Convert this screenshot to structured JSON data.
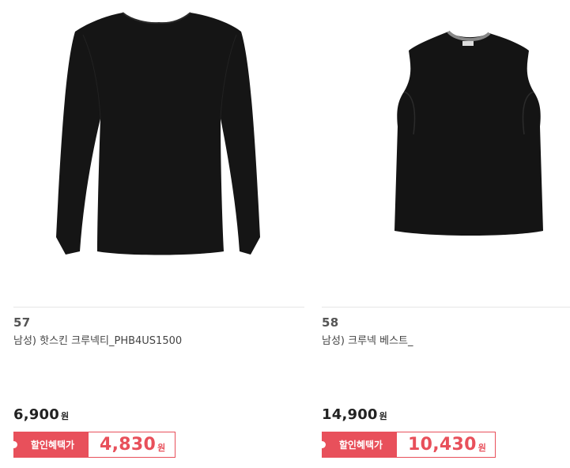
{
  "products": [
    {
      "rank": "57",
      "name": "남성) 핫스킨 크루넥티_PHB4US1500",
      "price": "6,900",
      "price_unit": "원",
      "discount_label": "할인혜택가",
      "discount_price": "4,830",
      "discount_unit": "원",
      "image": "long-sleeve-black-crewneck-shirt"
    },
    {
      "rank": "58",
      "name": "남성) 크루넥 베스트_",
      "price": "14,900",
      "price_unit": "원",
      "discount_label": "할인혜택가",
      "discount_price": "10,430",
      "discount_unit": "원",
      "image": "black-crewneck-vest"
    }
  ],
  "colors": {
    "accent": "#e8505b",
    "text": "#333333",
    "divider": "#e6e6e6"
  }
}
